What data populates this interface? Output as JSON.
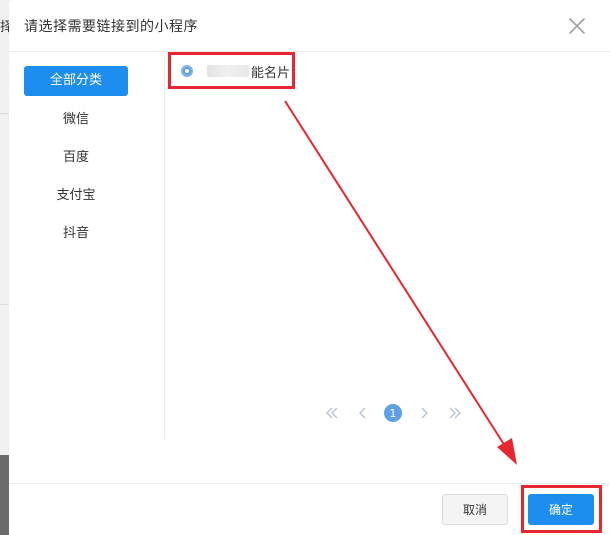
{
  "background": {
    "partial_char": "择"
  },
  "dialog": {
    "title": "请选择需要链接到的小程序",
    "close_icon": "close-icon"
  },
  "sidebar": {
    "items": [
      {
        "label": "全部分类",
        "active": true
      },
      {
        "label": "微信",
        "active": false
      },
      {
        "label": "百度",
        "active": false
      },
      {
        "label": "支付宝",
        "active": false
      },
      {
        "label": "抖音",
        "active": false
      }
    ]
  },
  "programs": [
    {
      "label_visible": "能名片",
      "selected": true
    }
  ],
  "pagination": {
    "first_icon": "double-chevron-left-icon",
    "prev_icon": "chevron-left-icon",
    "current_page": "1",
    "next_icon": "chevron-right-icon",
    "last_icon": "double-chevron-right-icon"
  },
  "footer": {
    "cancel_label": "取消",
    "confirm_label": "确定"
  },
  "colors": {
    "primary": "#1e8df0",
    "radio": "#5f9fe6",
    "annotation": "#e8262f",
    "overlay": "#6b6b6b"
  }
}
